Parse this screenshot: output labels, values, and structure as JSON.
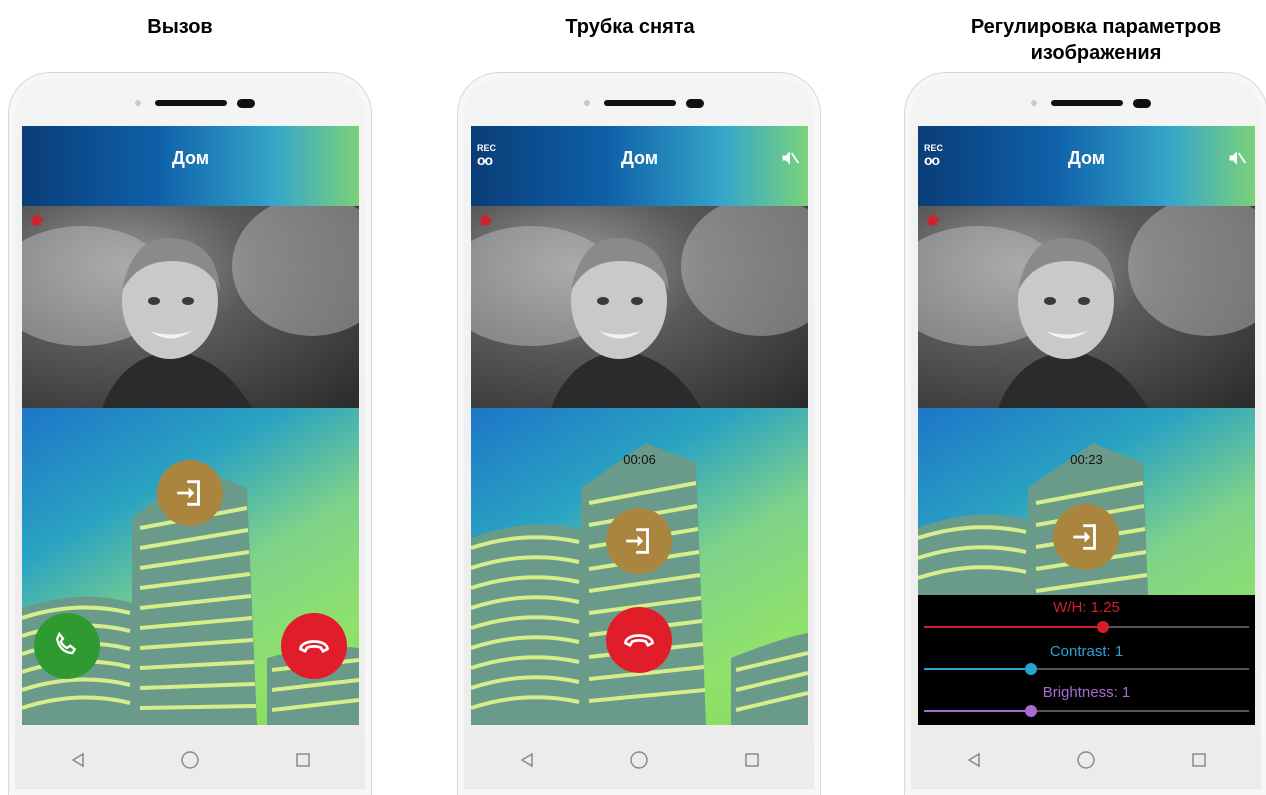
{
  "captions": [
    "Вызов",
    "Трубка снята",
    "Регулировка параметров изображения"
  ],
  "screens": [
    {
      "title": "Дом",
      "state": "incoming-call"
    },
    {
      "title": "Дом",
      "rec_label": "REC",
      "timer": "00:06",
      "state": "call-answered"
    },
    {
      "title": "Дом",
      "rec_label": "REC",
      "timer": "00:23",
      "state": "image-settings",
      "sliders": [
        {
          "label": "W/H: 1.25",
          "color": "#d21f2a",
          "value": 0.55
        },
        {
          "label": "Contrast: 1",
          "color": "#29a3d6",
          "value": 0.33
        },
        {
          "label": "Brightness: 1",
          "color": "#a86bcf",
          "value": 0.33
        }
      ]
    }
  ],
  "colors": {
    "door_button": "#a9853e",
    "answer_button": "#2f9a2f",
    "hangup_button": "#e11d2a",
    "gear": "#d21f2a"
  },
  "icons": [
    "gear-icon",
    "door-open-icon",
    "phone-answer-icon",
    "phone-hangup-icon",
    "mute-icon",
    "rec-icon",
    "nav-back-icon",
    "nav-home-icon",
    "nav-recents-icon"
  ]
}
